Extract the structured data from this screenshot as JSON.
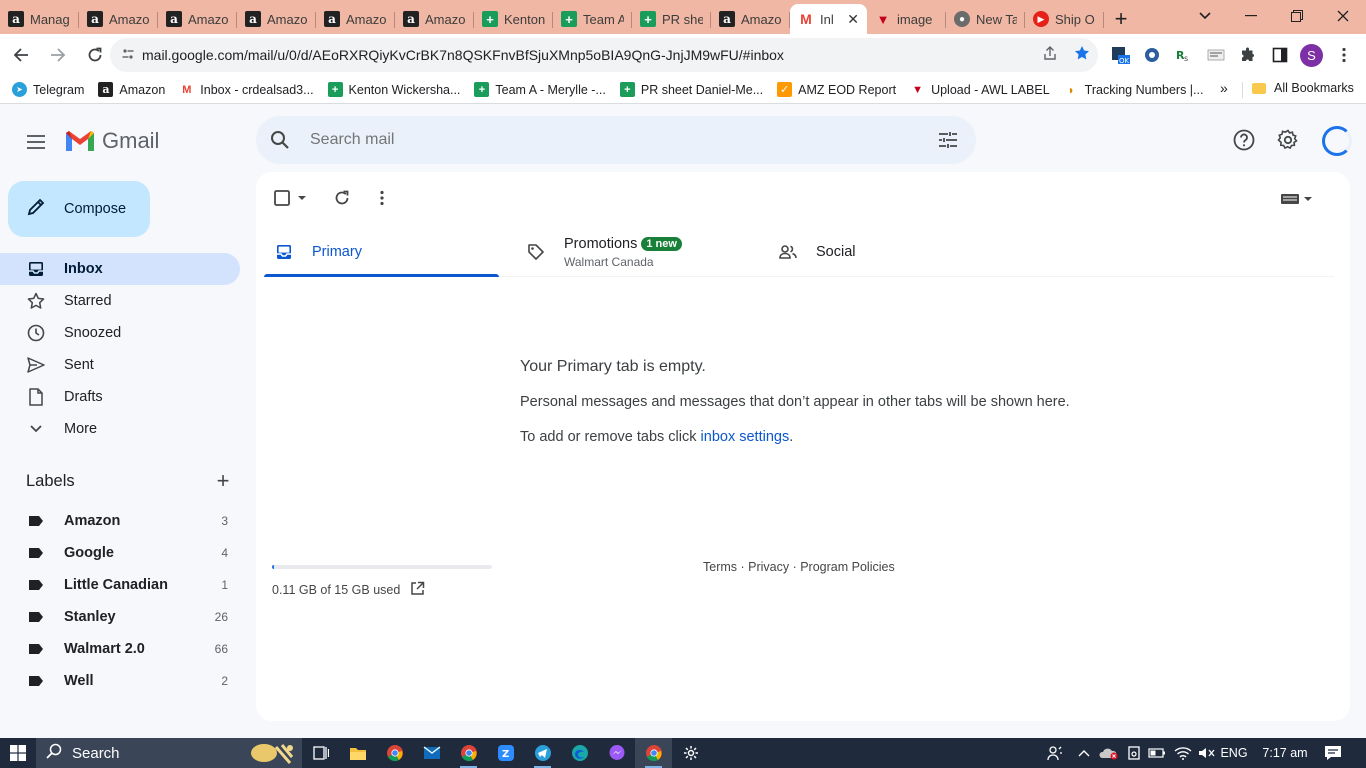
{
  "browser": {
    "tabs": [
      {
        "label": "Manag",
        "favicon": "amazon-icon",
        "active": false
      },
      {
        "label": "Amazo",
        "favicon": "amazon-icon",
        "active": false
      },
      {
        "label": "Amazo",
        "favicon": "amazon-icon",
        "active": false
      },
      {
        "label": "Amazo",
        "favicon": "amazon-icon",
        "active": false
      },
      {
        "label": "Amazo",
        "favicon": "amazon-icon",
        "active": false
      },
      {
        "label": "Amazo",
        "favicon": "amazon-icon",
        "active": false
      },
      {
        "label": "Kenton",
        "favicon": "sheets-icon",
        "active": false
      },
      {
        "label": "Team A",
        "favicon": "sheets-icon",
        "active": false
      },
      {
        "label": "PR shee",
        "favicon": "sheets-icon",
        "active": false
      },
      {
        "label": "Amazo",
        "favicon": "amazon-icon",
        "active": false
      },
      {
        "label": "Inl",
        "favicon": "gmail-icon",
        "active": true
      },
      {
        "label": "image",
        "favicon": "awl-icon",
        "active": false
      },
      {
        "label": "New Ta",
        "favicon": "chrome-icon",
        "active": false
      },
      {
        "label": "Ship O",
        "favicon": "youtube-icon",
        "active": false
      }
    ],
    "url": "mail.google.com/mail/u/0/d/AEoRXRQiyKvCrBK7n8QSKFnvBfSjuXMnp5oBIA9QnG-JnjJM9wFU/#inbox",
    "profile_initial": "S",
    "bookmarks": [
      {
        "label": "Telegram",
        "icon": "telegram-icon"
      },
      {
        "label": "Amazon",
        "icon": "amazon-icon"
      },
      {
        "label": "Inbox - crdealsad3...",
        "icon": "gmail-icon"
      },
      {
        "label": "Kenton Wickersha...",
        "icon": "sheets-icon"
      },
      {
        "label": "Team A - Merylle -...",
        "icon": "sheets-icon"
      },
      {
        "label": "PR sheet Daniel-Me...",
        "icon": "sheets-icon"
      },
      {
        "label": "AMZ EOD Report",
        "icon": "amz-icon"
      },
      {
        "label": "Upload - AWL LABEL",
        "icon": "awl-icon"
      },
      {
        "label": "Tracking Numbers |...",
        "icon": "taco-icon"
      }
    ],
    "bookmarks_more": "»",
    "all_bookmarks": "All Bookmarks"
  },
  "gmail": {
    "wordmark": "Gmail",
    "search_placeholder": "Search mail",
    "compose_label": "Compose",
    "nav": [
      {
        "label": "Inbox",
        "icon": "inbox-icon",
        "active": true
      },
      {
        "label": "Starred",
        "icon": "star-icon",
        "active": false
      },
      {
        "label": "Snoozed",
        "icon": "clock-icon",
        "active": false
      },
      {
        "label": "Sent",
        "icon": "send-icon",
        "active": false
      },
      {
        "label": "Drafts",
        "icon": "draft-icon",
        "active": false
      },
      {
        "label": "More",
        "icon": "chevron-down-icon",
        "active": false
      }
    ],
    "labels_heading": "Labels",
    "labels": [
      {
        "name": "Amazon",
        "count": "3"
      },
      {
        "name": "Google",
        "count": "4"
      },
      {
        "name": "Little Canadian",
        "count": "1"
      },
      {
        "name": "Stanley",
        "count": "26"
      },
      {
        "name": "Walmart 2.0",
        "count": "66"
      },
      {
        "name": "Well",
        "count": "2"
      }
    ],
    "tabs": {
      "primary": "Primary",
      "promotions": "Promotions",
      "promotions_badge": "1 new",
      "promotions_sub": "Walmart Canada",
      "social": "Social"
    },
    "empty": {
      "title": "Your Primary tab is empty.",
      "line1": "Personal messages and messages that don’t appear in other tabs will be shown here.",
      "line2_prefix": "To add or remove tabs click ",
      "line2_link": "inbox settings",
      "line2_suffix": "."
    },
    "storage": {
      "text": "0.11 GB of 15 GB used",
      "fraction": 0.0073
    },
    "footer": "Terms · Privacy · Program Policies"
  },
  "taskbar": {
    "search_label": "Search",
    "language": "ENG",
    "time": "7:17 am"
  },
  "colors": {
    "tabstrip": "#f0b8a4",
    "compose_bg": "#c2e7ff",
    "inbox_active_bg": "#d3e3fd",
    "primary_accent": "#0b57d0",
    "badge_green": "#188038",
    "taskbar": "#1f2b3d"
  }
}
